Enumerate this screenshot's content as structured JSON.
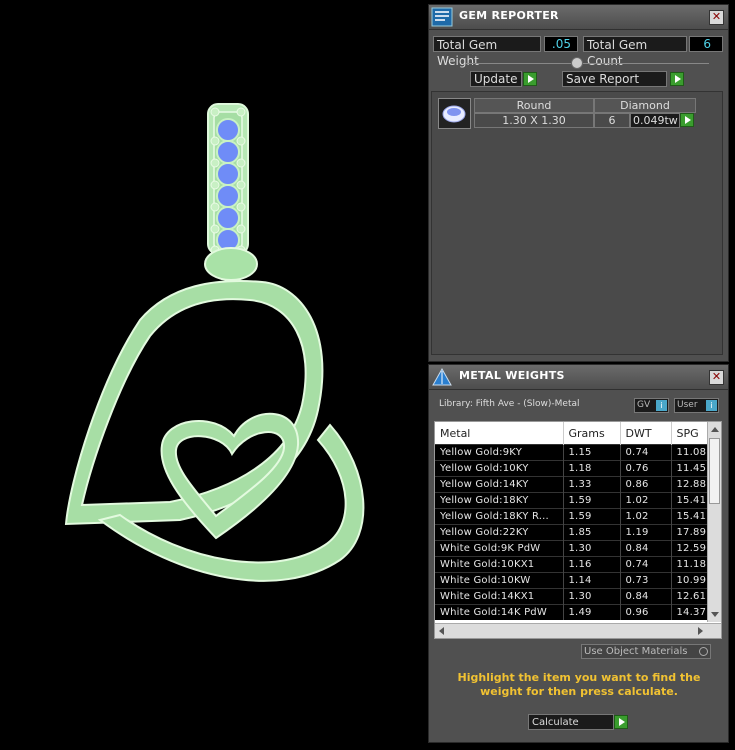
{
  "gem_reporter": {
    "title": "GEM REPORTER",
    "total_weight_label": "Total Gem Weight",
    "total_weight_value": ".05",
    "total_count_label": "Total Gem Count",
    "total_count_value": "6",
    "update_label": "Update",
    "save_report_label": "Save Report",
    "gem": {
      "shape": "Round",
      "material": "Diamond",
      "size": "1.30 X 1.30",
      "count": "6",
      "weight": "0.049tw"
    }
  },
  "metal_weights": {
    "title": "METAL WEIGHTS",
    "library": "Library: Fifth Ave - (Slow)-Metal",
    "gv_label": "GV",
    "user_label": "User",
    "columns": [
      "Metal",
      "Grams",
      "DWT",
      "SPG"
    ],
    "rows": [
      [
        "Yellow Gold:9KY",
        "1.15",
        "0.74",
        "11.08"
      ],
      [
        "Yellow Gold:10KY",
        "1.18",
        "0.76",
        "11.45"
      ],
      [
        "Yellow Gold:14KY",
        "1.33",
        "0.86",
        "12.88"
      ],
      [
        "Yellow Gold:18KY",
        "1.59",
        "1.02",
        "15.41"
      ],
      [
        "Yellow Gold:18KY R...",
        "1.59",
        "1.02",
        "15.41"
      ],
      [
        "Yellow Gold:22KY",
        "1.85",
        "1.19",
        "17.89"
      ],
      [
        "White Gold:9K PdW",
        "1.30",
        "0.84",
        "12.59"
      ],
      [
        "White Gold:10KX1",
        "1.16",
        "0.74",
        "11.18"
      ],
      [
        "White Gold:10KW",
        "1.14",
        "0.73",
        "10.99"
      ],
      [
        "White Gold:14KX1",
        "1.30",
        "0.84",
        "12.61"
      ],
      [
        "White Gold:14K PdW",
        "1.49",
        "0.96",
        "14.37"
      ]
    ],
    "use_object_materials": "Use Object Materials",
    "hint": "Highlight the item you want to find the weight for then press calculate.",
    "calculate_label": "Calculate"
  },
  "colors": {
    "metal_green": "#c8f0c8",
    "gem_blue": "#6a8cff",
    "accent_cyan": "#4fd2e8",
    "hint_yellow": "#f1c232",
    "go_green": "#3a9d2e"
  }
}
